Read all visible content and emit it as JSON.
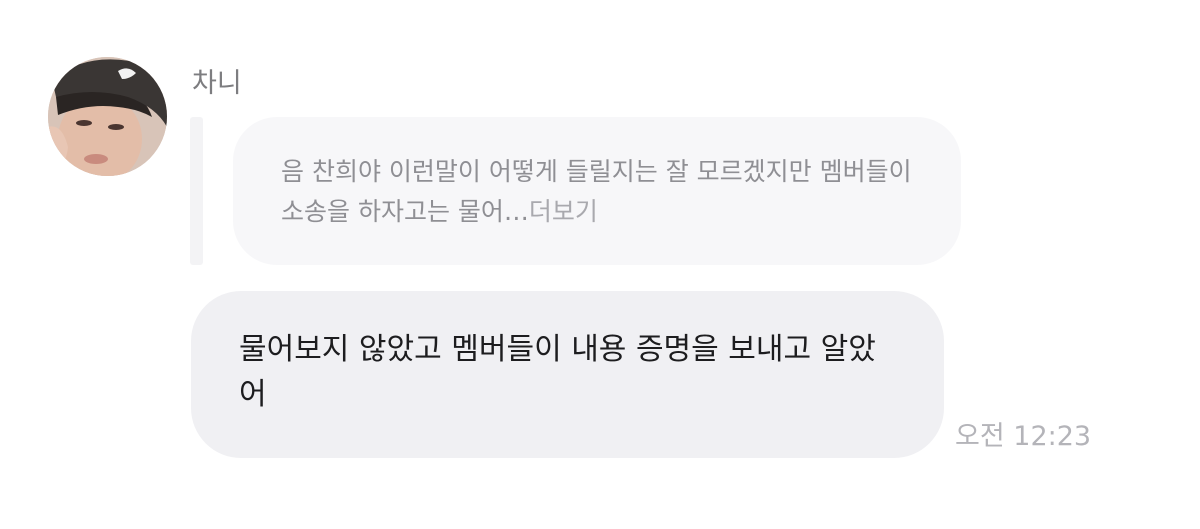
{
  "chat": {
    "sender_name": "차니",
    "avatar_icon": "profile-photo-avatar",
    "reply_preview": {
      "text": "음 찬희야 이런말이 어떻게 들릴지는 잘 모르겠지만 멤버들이 소송을 하자고는 물어…",
      "more_label": "더보기"
    },
    "message": {
      "text": "물어보지 않았고 멤버들이 내용 증명을 보내고 알았어"
    },
    "timestamp": "오전 12:23"
  },
  "colors": {
    "reply_bubble": "#f7f7f9",
    "message_bubble": "#f0f0f3",
    "timestamp": "#b4b4b9",
    "sender": "#7d7d80"
  }
}
